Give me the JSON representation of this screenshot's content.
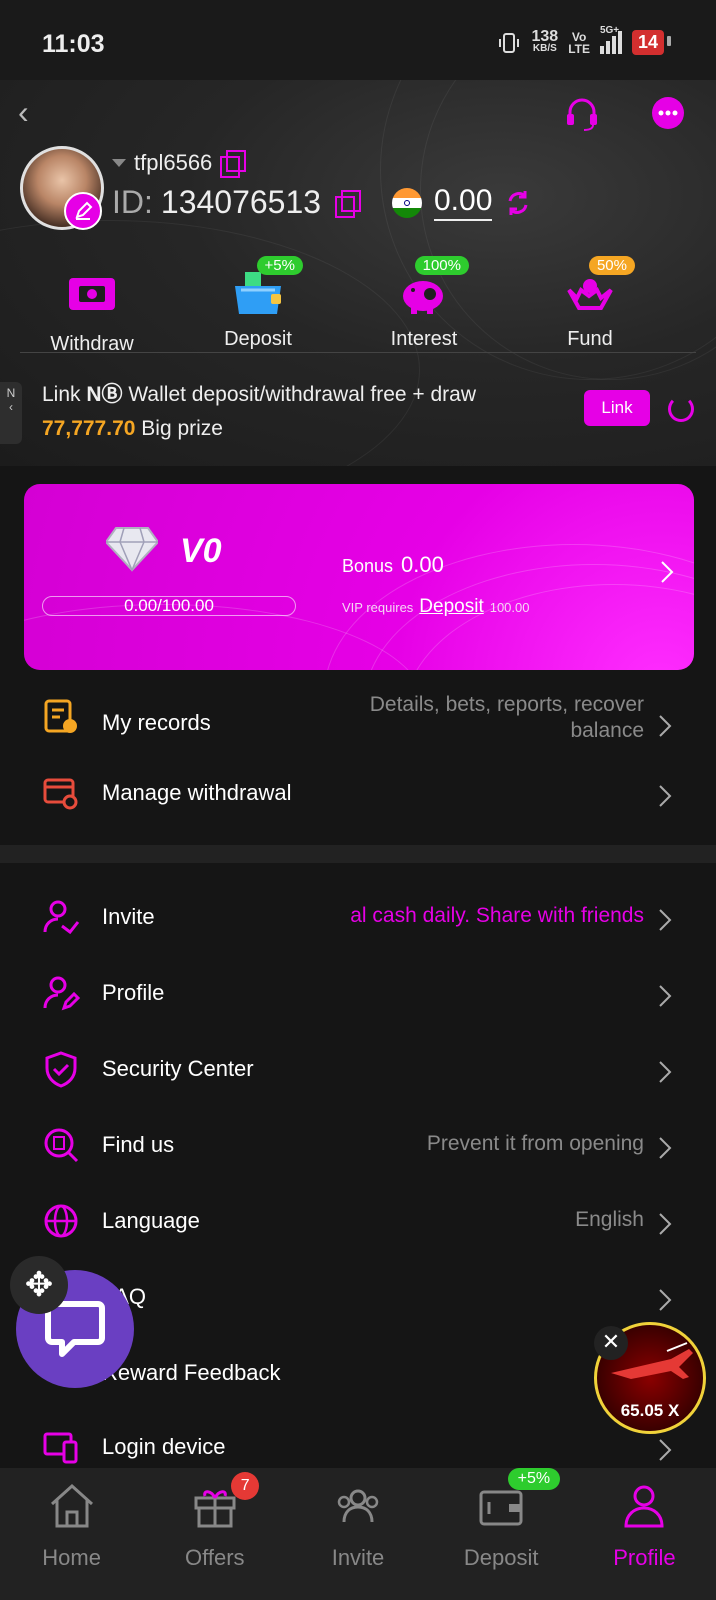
{
  "status_bar": {
    "time": "11:03",
    "net_speed": "138",
    "net_unit": "KB/S",
    "volte_top": "Vo",
    "volte_bottom": "LTE",
    "network": "5G+",
    "battery": "14"
  },
  "header": {
    "username": "tfpl6566",
    "id_label": "ID:",
    "id_value": "134076513",
    "balance": "0.00"
  },
  "quick_actions": [
    {
      "label": "Withdraw",
      "badge": ""
    },
    {
      "label": "Deposit",
      "badge": "+5%"
    },
    {
      "label": "Interest",
      "badge": "100%"
    },
    {
      "label": "Fund",
      "badge": "50%"
    }
  ],
  "wallet_promo": {
    "side_tab": "N",
    "text_pre": "Link",
    "brand": "NⒷ",
    "text_mid": "Wallet deposit/withdrawal free + draw",
    "prize": "77,777.70",
    "text_post": "Big prize",
    "link_button": "Link"
  },
  "vip": {
    "level": "V0",
    "progress": "0.00/100.00",
    "progress_fraction": 0,
    "bonus_label": "Bonus",
    "bonus_value": "0.00",
    "requires_label": "VIP requires",
    "requires_link": "Deposit",
    "requires_value": "100.00"
  },
  "records": [
    {
      "label": "My records",
      "right": "Details, bets, reports, recover balance"
    },
    {
      "label": "Manage withdrawal",
      "right": ""
    }
  ],
  "menu": [
    {
      "label": "Invite",
      "right": "al cash daily.  Share with friends"
    },
    {
      "label": "Profile",
      "right": ""
    },
    {
      "label": "Security Center",
      "right": ""
    },
    {
      "label": "Find us",
      "right": "Prevent it from opening"
    },
    {
      "label": "Language",
      "right": "English"
    },
    {
      "label": "FAQ",
      "right": ""
    },
    {
      "label": "Reward Feedback",
      "right": ""
    },
    {
      "label": "Login device",
      "right": ""
    }
  ],
  "game_widget": {
    "multiplier": "65.05 X"
  },
  "bottom_nav": [
    {
      "label": "Home",
      "badge": ""
    },
    {
      "label": "Offers",
      "badge": "7"
    },
    {
      "label": "Invite",
      "badge": ""
    },
    {
      "label": "Deposit",
      "badge": "+5%"
    },
    {
      "label": "Profile",
      "badge": ""
    }
  ],
  "colors": {
    "accent": "#e600e6",
    "badge_green": "#2ecc2e",
    "badge_orange": "#f5a623",
    "prize": "#f5a623",
    "chat_fab": "#6a3fc2"
  }
}
